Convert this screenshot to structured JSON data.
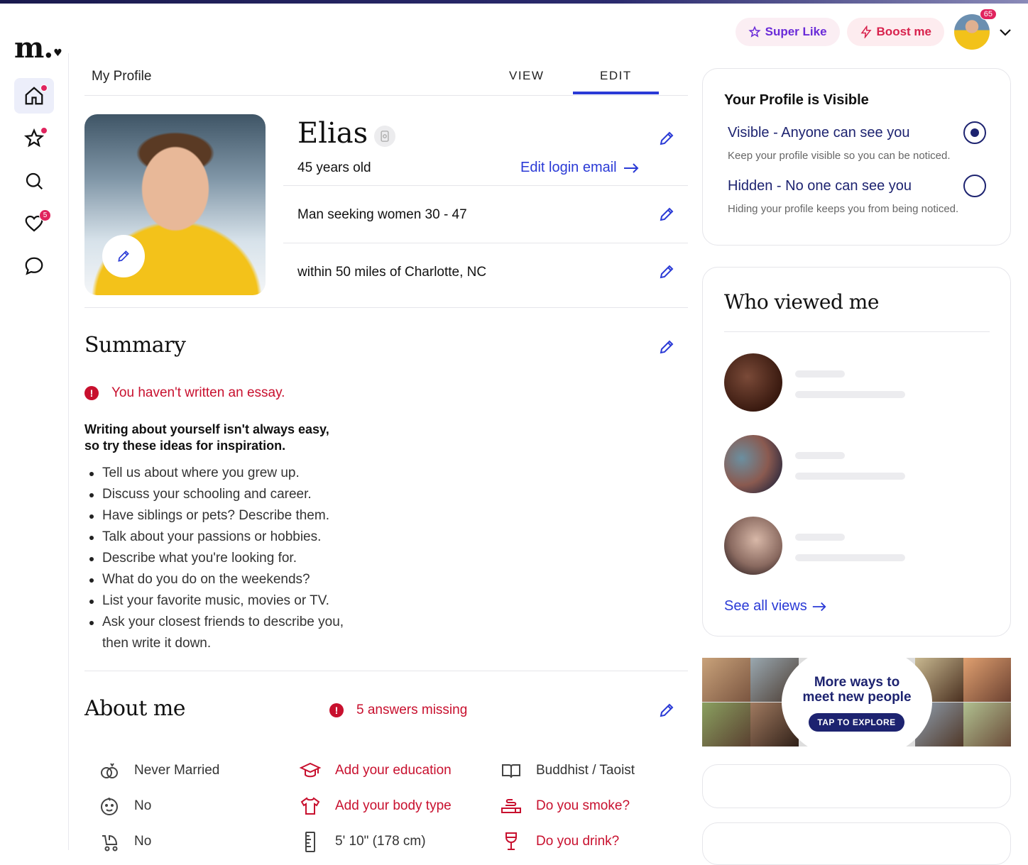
{
  "brand": {
    "logo": "m.",
    "logo_heart": "♥"
  },
  "nav": {
    "likes_badge": "5",
    "accent": "#e0245e"
  },
  "top": {
    "super_like": "Super Like",
    "boost": "Boost me",
    "avatar_badge": "65"
  },
  "header": {
    "title": "My Profile",
    "tab_view": "VIEW",
    "tab_edit": "EDIT"
  },
  "profile": {
    "name": "Elias",
    "age": "45 years old",
    "edit_login": "Edit login email",
    "seeking": "Man seeking women 30 - 47",
    "location": "within 50 miles of Charlotte, NC"
  },
  "summary": {
    "title": "Summary",
    "warning": "You haven't written an essay.",
    "tips_head_1": "Writing about yourself isn't always easy,",
    "tips_head_2": "so try these ideas for inspiration.",
    "tips": [
      "Tell us about where you grew up.",
      "Discuss your schooling and career.",
      "Have siblings or pets? Describe them.",
      "Talk about your passions or hobbies.",
      "Describe what you're looking for.",
      "What do you do on the weekends?",
      "List your favorite music, movies or TV.",
      "Ask your closest friends to describe you, then write it down."
    ]
  },
  "about": {
    "title": "About me",
    "missing": "5 answers missing",
    "items": [
      {
        "label": "Never Married",
        "icon": "rings-icon",
        "missing": false
      },
      {
        "label": "Add your education",
        "icon": "graduation-cap-icon",
        "missing": true
      },
      {
        "label": "Buddhist / Taoist",
        "icon": "book-icon",
        "missing": false
      },
      {
        "label": "No",
        "icon": "baby-face-icon",
        "missing": false
      },
      {
        "label": "Add your body type",
        "icon": "shirt-icon",
        "missing": true
      },
      {
        "label": "Do you smoke?",
        "icon": "smoke-icon",
        "missing": true
      },
      {
        "label": "No",
        "icon": "stroller-icon",
        "missing": false
      },
      {
        "label": "5' 10\" (178 cm)",
        "icon": "ruler-icon",
        "missing": false
      },
      {
        "label": "Do you drink?",
        "icon": "wine-glass-icon",
        "missing": true
      }
    ]
  },
  "visibility": {
    "title": "Your Profile is Visible",
    "visible_label": "Visible - Anyone can see you",
    "visible_desc": "Keep your profile visible so you can be noticed.",
    "hidden_label": "Hidden - No one can see you",
    "hidden_desc": "Hiding your profile keeps you from being noticed.",
    "selected": "visible"
  },
  "viewers": {
    "title": "Who viewed me",
    "see_all": "See all views"
  },
  "banner": {
    "line1": "More ways to",
    "line2": "meet new people",
    "button": "TAP TO EXPLORE"
  },
  "colors": {
    "link": "#2a3ad6",
    "error": "#c8102e",
    "navy": "#1d2370"
  }
}
